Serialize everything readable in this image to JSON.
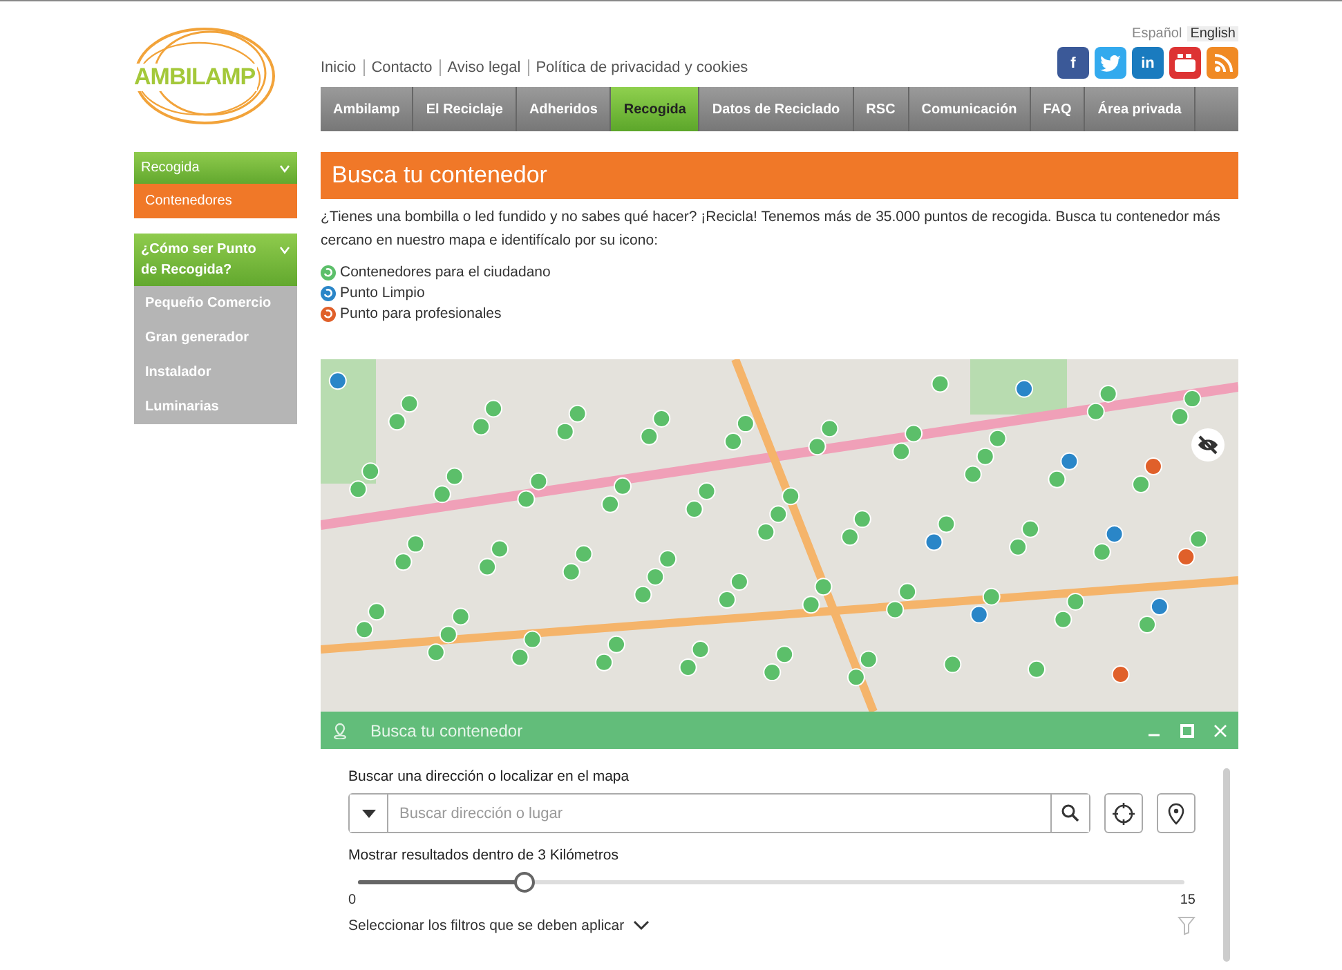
{
  "logo": {
    "text": "AMBILAMP"
  },
  "top_links": [
    "Inicio",
    "Contacto",
    "Aviso legal",
    "Política de privacidad y cookies"
  ],
  "languages": [
    {
      "label": "Español",
      "selected": false
    },
    {
      "label": "English",
      "selected": true
    }
  ],
  "social": [
    {
      "kind": "facebook",
      "label": "f",
      "color": "#3b5998"
    },
    {
      "kind": "twitter",
      "color": "#33aaee"
    },
    {
      "kind": "linkedin",
      "label": "in",
      "color": "#1a7bbf"
    },
    {
      "kind": "youtube",
      "color": "#dd3333"
    },
    {
      "kind": "rss",
      "color": "#f08a24"
    }
  ],
  "nav": [
    {
      "label": "Ambilamp",
      "selected": false
    },
    {
      "label": "El Reciclaje",
      "selected": false
    },
    {
      "label": "Adheridos",
      "selected": false
    },
    {
      "label": "Recogida",
      "selected": true
    },
    {
      "label": "Datos de Reciclado",
      "selected": false
    },
    {
      "label": "RSC",
      "selected": false
    },
    {
      "label": "Comunicación",
      "selected": false
    },
    {
      "label": "FAQ",
      "selected": false
    },
    {
      "label": "Área privada",
      "selected": false
    }
  ],
  "sidebar": [
    {
      "title": "Recogida",
      "expanded": true,
      "items": [
        {
          "label": "Contenedores",
          "selected": true
        }
      ]
    },
    {
      "title": "¿Cómo ser Punto de Recogida?",
      "expanded": true,
      "items": [
        {
          "label": "Pequeño Comercio",
          "selected": false
        },
        {
          "label": "Gran generador",
          "selected": false
        },
        {
          "label": "Instalador",
          "selected": false
        },
        {
          "label": "Luminarias",
          "selected": false
        }
      ]
    }
  ],
  "heading": "Busca tu contenedor",
  "intro": "¿Tienes una bombilla o led fundido y no sabes qué hacer? ¡Recicla! Tenemos más de 35.000 puntos de recogida. Busca tu contenedor más cercano en nuestro mapa e identifícalo por su icono:",
  "legend": [
    {
      "label": "Contenedores para el ciudadano",
      "color": "#5cbf6a"
    },
    {
      "label": "Punto Limpio",
      "color": "#2a86c8"
    },
    {
      "label": "Punto para profesionales",
      "color": "#e0602a"
    }
  ],
  "panel": {
    "title": "Busca tu contenedor",
    "search_label": "Buscar una dirección o localizar en el mapa",
    "placeholder": "Buscar dirección o lugar",
    "range_label": "Mostrar resultados dentro de 3 Kilómetros",
    "level": 0.2,
    "min": "0",
    "max": "15",
    "filters_label": "Seleccionar los filtros que se deben aplicar"
  }
}
